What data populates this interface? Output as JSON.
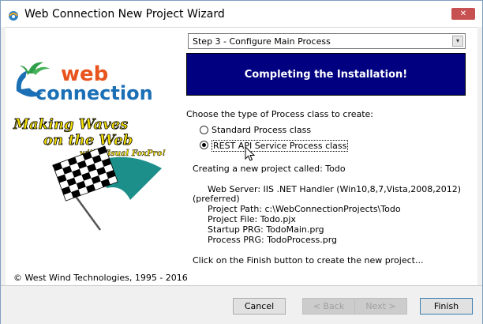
{
  "window": {
    "title": "Web Connection New Project Wizard",
    "close_glyph": "✕"
  },
  "step_select": {
    "value": "Step 3 - Configure Main Process",
    "arrow": "▾"
  },
  "banner": {
    "text": "Completing the Installation!"
  },
  "process_type": {
    "label": "Choose the type of Process class to create:",
    "options": [
      {
        "label": "Standard Process class",
        "selected": false
      },
      {
        "label": "REST API Service Process class",
        "selected": true
      }
    ]
  },
  "info": {
    "creating": "Creating a new project called: Todo",
    "web_server": "Web Server: IIS .NET Handler (Win10,8,7,Vista,2008,2012)",
    "preferred": "(preferred)",
    "project_path": "Project Path: c:\\WebConnectionProjects\\Todo",
    "project_file": "Project File: Todo.pjx",
    "startup_prg": "Startup PRG: TodoMain.prg",
    "process_prg": "Process PRG: TodoProcess.prg",
    "finish_hint": "Click on the Finish button to create the new project..."
  },
  "left_panel": {
    "logo_line1": "web",
    "logo_line2": "connection",
    "slogan_line1": "Making Waves",
    "slogan_line2": "on the Web",
    "slogan_line3": "with Visual FoxPro!",
    "copyright": "© West Wind Technologies, 1995 - 2016"
  },
  "buttons": {
    "cancel": "Cancel",
    "back": "< Back",
    "next": "Next >",
    "finish": "Finish"
  },
  "colors": {
    "banner_bg": "#000080",
    "logo_orange": "#e8541e",
    "logo_blue": "#1a6fb5",
    "slogan_yellow": "#f5e000"
  }
}
